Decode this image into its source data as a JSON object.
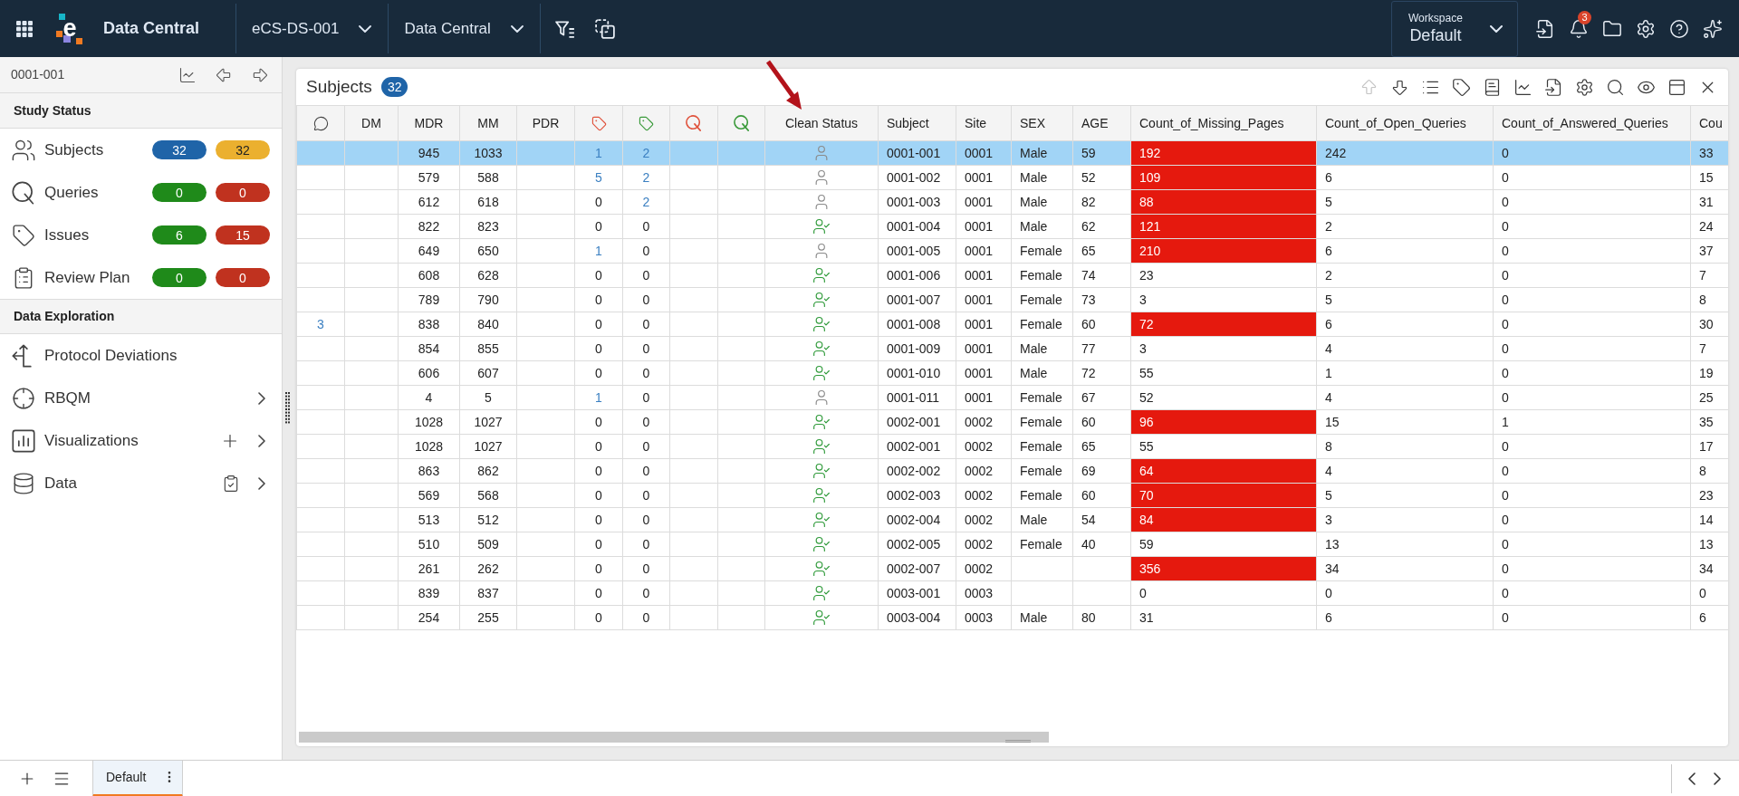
{
  "top_bar": {
    "logo_text": "e",
    "app_name": "Data Central",
    "dropdowns": [
      {
        "label": "eCS-DS-001"
      },
      {
        "label": "Data Central"
      }
    ],
    "workspace": {
      "label": "Workspace",
      "value": "Default"
    },
    "notification_count": "3"
  },
  "sidebar": {
    "subject_id": "0001-001",
    "sections": [
      {
        "title": "Study Status",
        "items": [
          {
            "kind": "counter",
            "label": "Subjects",
            "badges": [
              {
                "text": "32",
                "color": "#1f64a8"
              },
              {
                "text": "32",
                "color": "#ebb02f"
              }
            ]
          },
          {
            "kind": "counter",
            "label": "Queries",
            "badges": [
              {
                "text": "0",
                "color": "#1f8a1a"
              },
              {
                "text": "0",
                "color": "#c0321f"
              }
            ]
          },
          {
            "kind": "counter",
            "label": "Issues",
            "badges": [
              {
                "text": "6",
                "color": "#1f8a1a"
              },
              {
                "text": "15",
                "color": "#c0321f"
              }
            ]
          },
          {
            "kind": "counter",
            "label": "Review Plan",
            "badges": [
              {
                "text": "0",
                "color": "#1f8a1a"
              },
              {
                "text": "0",
                "color": "#c0321f"
              }
            ]
          }
        ]
      },
      {
        "title": "Data Exploration",
        "items": [
          {
            "kind": "link",
            "label": "Protocol Deviations"
          },
          {
            "kind": "group",
            "label": "RBQM",
            "expanded": false
          },
          {
            "kind": "group",
            "label": "Visualizations",
            "expanded": false
          },
          {
            "kind": "group",
            "label": "Data",
            "expanded": false
          }
        ]
      }
    ]
  },
  "panel": {
    "title": "Subjects",
    "count": "32",
    "toolbar": [
      {
        "disabled": true
      },
      {
        "disabled": false
      },
      {
        "disabled": false
      },
      {
        "disabled": false
      },
      {
        "disabled": false
      },
      {
        "disabled": false
      },
      {
        "disabled": false
      },
      {
        "disabled": false
      },
      {
        "disabled": false
      },
      {
        "disabled": false
      },
      {
        "disabled": false
      },
      {
        "disabled": false
      }
    ]
  },
  "table": {
    "columns": [
      {
        "kind": "comment"
      },
      {
        "kind": "number",
        "label": "DM"
      },
      {
        "kind": "number",
        "label": "MDR"
      },
      {
        "kind": "number",
        "label": "MM"
      },
      {
        "kind": "number",
        "label": "PDR"
      },
      {
        "kind": "tag",
        "color": "#e0533d"
      },
      {
        "kind": "tag",
        "color": "#3a9a3a"
      },
      {
        "kind": "query",
        "color": "#e0533d"
      },
      {
        "kind": "query",
        "color": "#3a9a3a"
      },
      {
        "kind": "status",
        "label": "Clean Status"
      },
      {
        "kind": "text",
        "label": "Subject"
      },
      {
        "kind": "text",
        "label": "Site"
      },
      {
        "kind": "text",
        "label": "SEX"
      },
      {
        "kind": "text",
        "label": "AGE"
      },
      {
        "kind": "text",
        "label": "Count_of_Missing_Pages"
      },
      {
        "kind": "text",
        "label": "Count_of_Open_Queries"
      },
      {
        "kind": "text",
        "label": "Count_of_Answered_Queries"
      },
      {
        "kind": "text",
        "label": "Cou"
      }
    ],
    "rows": [
      {
        "selected": true,
        "cells": [
          null,
          null,
          "945",
          "1033",
          null,
          {
            "text": "1",
            "link": true
          },
          {
            "text": "2",
            "link": true
          },
          null,
          null,
          {
            "clean": false
          },
          "0001-001",
          "0001",
          "Male",
          "59",
          {
            "text": "192",
            "alert": true
          },
          "242",
          "0",
          "33"
        ]
      },
      {
        "selected": false,
        "cells": [
          null,
          null,
          "579",
          "588",
          null,
          {
            "text": "5",
            "link": true
          },
          {
            "text": "2",
            "link": true
          },
          null,
          null,
          {
            "clean": false
          },
          "0001-002",
          "0001",
          "Male",
          "52",
          {
            "text": "109",
            "alert": true
          },
          "6",
          "0",
          "15"
        ]
      },
      {
        "selected": false,
        "cells": [
          null,
          null,
          "612",
          "618",
          null,
          {
            "text": "0",
            "link": false
          },
          {
            "text": "2",
            "link": true
          },
          null,
          null,
          {
            "clean": false
          },
          "0001-003",
          "0001",
          "Male",
          "82",
          {
            "text": "88",
            "alert": true
          },
          "5",
          "0",
          "31"
        ]
      },
      {
        "selected": false,
        "cells": [
          null,
          null,
          "822",
          "823",
          null,
          {
            "text": "0",
            "link": false
          },
          {
            "text": "0",
            "link": false
          },
          null,
          null,
          {
            "clean": true
          },
          "0001-004",
          "0001",
          "Male",
          "62",
          {
            "text": "121",
            "alert": true
          },
          "2",
          "0",
          "24"
        ]
      },
      {
        "selected": false,
        "cells": [
          null,
          null,
          "649",
          "650",
          null,
          {
            "text": "1",
            "link": true
          },
          {
            "text": "0",
            "link": false
          },
          null,
          null,
          {
            "clean": false
          },
          "0001-005",
          "0001",
          "Female",
          "65",
          {
            "text": "210",
            "alert": true
          },
          "6",
          "0",
          "37"
        ]
      },
      {
        "selected": false,
        "cells": [
          null,
          null,
          "608",
          "628",
          null,
          {
            "text": "0",
            "link": false
          },
          {
            "text": "0",
            "link": false
          },
          null,
          null,
          {
            "clean": true
          },
          "0001-006",
          "0001",
          "Female",
          "74",
          {
            "text": "23",
            "alert": false
          },
          "2",
          "0",
          "7"
        ]
      },
      {
        "selected": false,
        "cells": [
          null,
          null,
          "789",
          "790",
          null,
          {
            "text": "0",
            "link": false
          },
          {
            "text": "0",
            "link": false
          },
          null,
          null,
          {
            "clean": true
          },
          "0001-007",
          "0001",
          "Female",
          "73",
          {
            "text": "3",
            "alert": false
          },
          "5",
          "0",
          "8"
        ]
      },
      {
        "selected": false,
        "cells": [
          {
            "text": "3",
            "link": true
          },
          null,
          "838",
          "840",
          null,
          {
            "text": "0",
            "link": false
          },
          {
            "text": "0",
            "link": false
          },
          null,
          null,
          {
            "clean": true
          },
          "0001-008",
          "0001",
          "Female",
          "60",
          {
            "text": "72",
            "alert": true
          },
          "6",
          "0",
          "30"
        ]
      },
      {
        "selected": false,
        "cells": [
          null,
          null,
          "854",
          "855",
          null,
          {
            "text": "0",
            "link": false
          },
          {
            "text": "0",
            "link": false
          },
          null,
          null,
          {
            "clean": true
          },
          "0001-009",
          "0001",
          "Male",
          "77",
          {
            "text": "3",
            "alert": false
          },
          "4",
          "0",
          "7"
        ]
      },
      {
        "selected": false,
        "cells": [
          null,
          null,
          "606",
          "607",
          null,
          {
            "text": "0",
            "link": false
          },
          {
            "text": "0",
            "link": false
          },
          null,
          null,
          {
            "clean": true
          },
          "0001-010",
          "0001",
          "Male",
          "72",
          {
            "text": "55",
            "alert": false
          },
          "1",
          "0",
          "19"
        ]
      },
      {
        "selected": false,
        "cells": [
          null,
          null,
          "4",
          "5",
          null,
          {
            "text": "1",
            "link": true
          },
          {
            "text": "0",
            "link": false
          },
          null,
          null,
          {
            "clean": false
          },
          "0001-011",
          "0001",
          "Female",
          "67",
          {
            "text": "52",
            "alert": false
          },
          "4",
          "0",
          "25"
        ]
      },
      {
        "selected": false,
        "cells": [
          null,
          null,
          "1028",
          "1027",
          null,
          {
            "text": "0",
            "link": false
          },
          {
            "text": "0",
            "link": false
          },
          null,
          null,
          {
            "clean": true
          },
          "0002-001",
          "0002",
          "Female",
          "60",
          {
            "text": "96",
            "alert": true
          },
          "15",
          "1",
          "35"
        ]
      },
      {
        "selected": false,
        "cells": [
          null,
          null,
          "1028",
          "1027",
          null,
          {
            "text": "0",
            "link": false
          },
          {
            "text": "0",
            "link": false
          },
          null,
          null,
          {
            "clean": true
          },
          "0002-001",
          "0002",
          "Female",
          "65",
          {
            "text": "55",
            "alert": false
          },
          "8",
          "0",
          "17"
        ]
      },
      {
        "selected": false,
        "cells": [
          null,
          null,
          "863",
          "862",
          null,
          {
            "text": "0",
            "link": false
          },
          {
            "text": "0",
            "link": false
          },
          null,
          null,
          {
            "clean": true
          },
          "0002-002",
          "0002",
          "Female",
          "69",
          {
            "text": "64",
            "alert": true
          },
          "4",
          "0",
          "8"
        ]
      },
      {
        "selected": false,
        "cells": [
          null,
          null,
          "569",
          "568",
          null,
          {
            "text": "0",
            "link": false
          },
          {
            "text": "0",
            "link": false
          },
          null,
          null,
          {
            "clean": true
          },
          "0002-003",
          "0002",
          "Female",
          "60",
          {
            "text": "70",
            "alert": true
          },
          "5",
          "0",
          "23"
        ]
      },
      {
        "selected": false,
        "cells": [
          null,
          null,
          "513",
          "512",
          null,
          {
            "text": "0",
            "link": false
          },
          {
            "text": "0",
            "link": false
          },
          null,
          null,
          {
            "clean": true
          },
          "0002-004",
          "0002",
          "Male",
          "54",
          {
            "text": "84",
            "alert": true
          },
          "3",
          "0",
          "14"
        ]
      },
      {
        "selected": false,
        "cells": [
          null,
          null,
          "510",
          "509",
          null,
          {
            "text": "0",
            "link": false
          },
          {
            "text": "0",
            "link": false
          },
          null,
          null,
          {
            "clean": true
          },
          "0002-005",
          "0002",
          "Female",
          "40",
          {
            "text": "59",
            "alert": false
          },
          "13",
          "0",
          "13"
        ]
      },
      {
        "selected": false,
        "cells": [
          null,
          null,
          "261",
          "262",
          null,
          {
            "text": "0",
            "link": false
          },
          {
            "text": "0",
            "link": false
          },
          null,
          null,
          {
            "clean": true
          },
          "0002-007",
          "0002",
          null,
          null,
          {
            "text": "356",
            "alert": true
          },
          "34",
          "0",
          "34"
        ]
      },
      {
        "selected": false,
        "cells": [
          null,
          null,
          "839",
          "837",
          null,
          {
            "text": "0",
            "link": false
          },
          {
            "text": "0",
            "link": false
          },
          null,
          null,
          {
            "clean": true
          },
          "0003-001",
          "0003",
          null,
          null,
          {
            "text": "0",
            "alert": false
          },
          "0",
          "0",
          "0"
        ]
      },
      {
        "selected": false,
        "cells": [
          null,
          null,
          "254",
          "255",
          null,
          {
            "text": "0",
            "link": false
          },
          {
            "text": "0",
            "link": false
          },
          null,
          null,
          {
            "clean": true
          },
          "0003-004",
          "0003",
          "Male",
          "80",
          {
            "text": "31",
            "alert": false
          },
          "6",
          "0",
          "6"
        ]
      }
    ]
  },
  "bottom_bar": {
    "tabs": [
      {
        "label": "Default",
        "selected": true
      }
    ]
  }
}
